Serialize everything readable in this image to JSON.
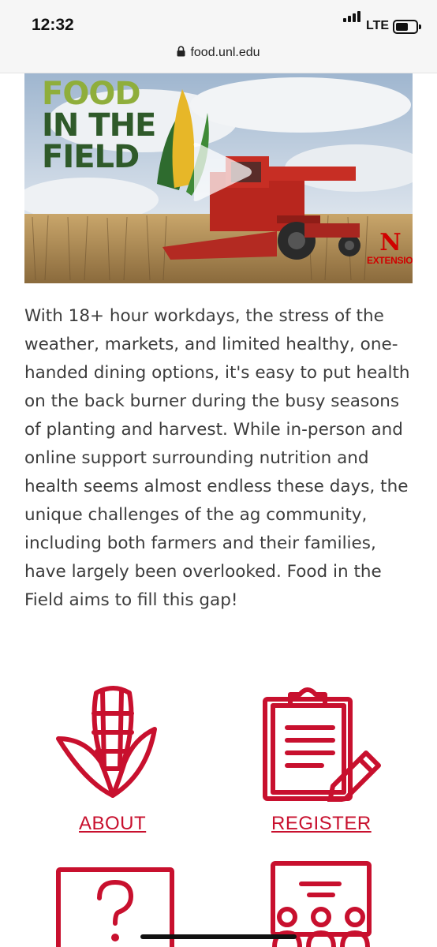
{
  "status_bar": {
    "time": "12:32",
    "network": "LTE"
  },
  "browser": {
    "url": "food.unl.edu"
  },
  "hero": {
    "logo_lines": [
      "FOOD",
      "IN THE",
      "FIELD"
    ],
    "badge_letter": "N",
    "badge_text": "EXTENSION"
  },
  "intro": {
    "paragraph": "With 18+ hour workdays, the stress of the weather, markets, and limited healthy, one-handed dining options, it's easy to put health on the back burner during the busy seasons of planting and harvest. While in-person and online support surrounding nutrition and health seems almost endless these days, the unique challenges of the ag community, including both farmers and their families, have largely been overlooked. Food in the Field aims to fill this gap!"
  },
  "tiles": {
    "about_label": "ABOUT",
    "register_label": "REGISTER"
  },
  "colors": {
    "accent": "#c8102e",
    "text": "#3c3c3c"
  }
}
